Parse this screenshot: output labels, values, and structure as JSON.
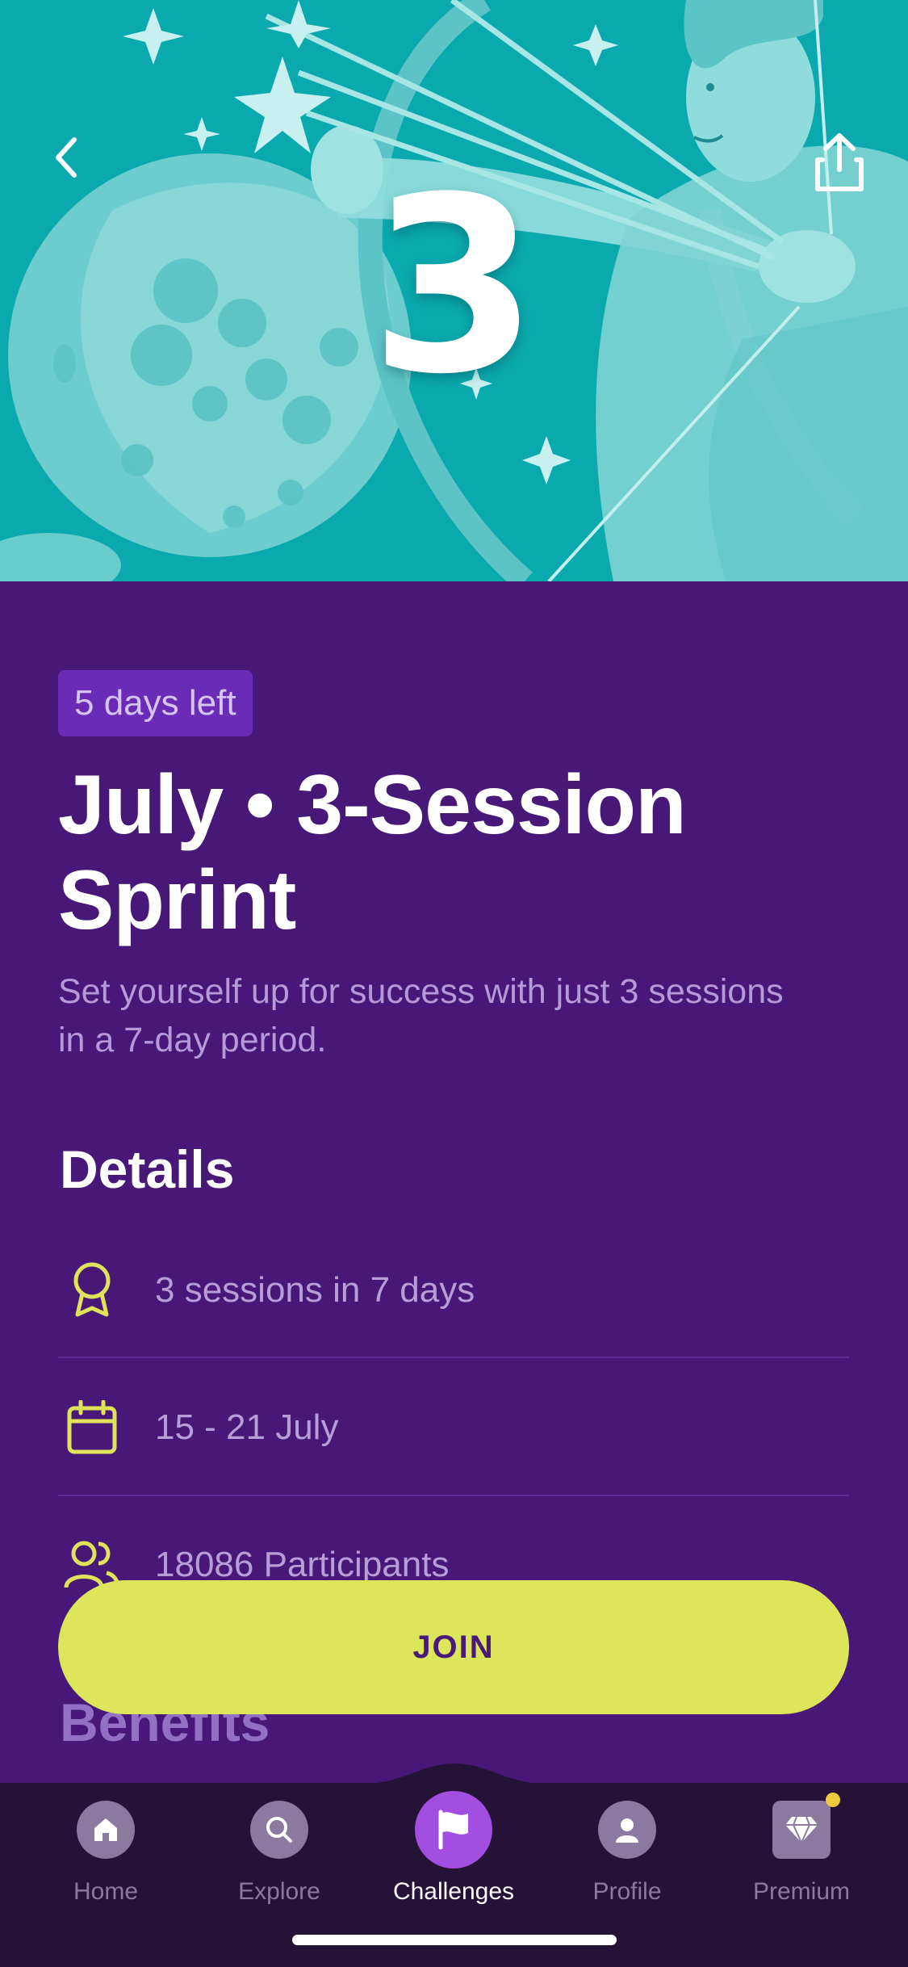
{
  "hero": {
    "number": "3"
  },
  "challenge": {
    "badge": "5 days left",
    "title": "July • 3-Session Sprint",
    "description": "Set yourself up for success with just 3 sessions in a 7-day period."
  },
  "details": {
    "heading": "Details",
    "items": [
      {
        "icon": "award-ribbon-icon",
        "text": "3 sessions in 7 days"
      },
      {
        "icon": "calendar-icon",
        "text": "15 - 21 July"
      },
      {
        "icon": "participants-icon",
        "text": "18086 Participants"
      }
    ]
  },
  "benefits": {
    "heading": "Benefits"
  },
  "join_button": "JOIN",
  "tabs": [
    {
      "label": "Home",
      "icon": "home-icon",
      "active": false
    },
    {
      "label": "Explore",
      "icon": "search-icon",
      "active": false
    },
    {
      "label": "Challenges",
      "icon": "flag-icon",
      "active": true
    },
    {
      "label": "Profile",
      "icon": "profile-icon",
      "active": false
    },
    {
      "label": "Premium",
      "icon": "diamond-icon",
      "active": false
    }
  ],
  "colors": {
    "hero_teal": "#0aa9ad",
    "background_purple": "#471877",
    "accent_yellow": "#dde65a",
    "tab_active": "#a24ee0"
  }
}
